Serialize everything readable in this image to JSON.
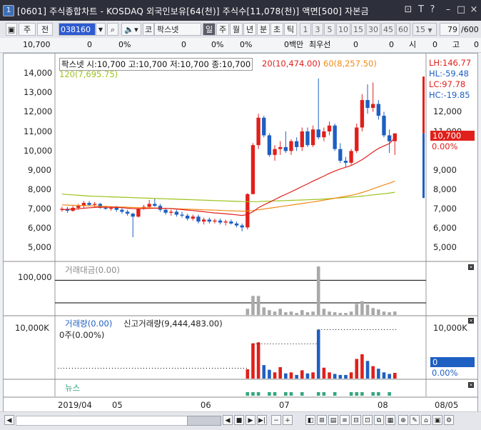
{
  "window": {
    "icon_label": "1",
    "title": "[0601] 주식종합차트 - KOSDAQ 외국인보유[64(천)] 주식수[11,078(천)] 액면[500] 자본금",
    "buttons": [
      "⊡",
      "T",
      "?",
      "–",
      "□",
      "×"
    ]
  },
  "toolbar": {
    "market": "주",
    "mode": "전",
    "code": "038160",
    "market_prefix": "코",
    "stock_name": "팍스넷",
    "period_buttons": [
      "일",
      "주",
      "월",
      "년",
      "분",
      "초",
      "틱"
    ],
    "interval_buttons": [
      "1",
      "3",
      "5",
      "10",
      "15",
      "30",
      "45",
      "60"
    ],
    "interval_selected": "15",
    "count": "79",
    "count_total": "/600"
  },
  "infobar": {
    "price": "10,700",
    "change": "0",
    "change_pct": "0%",
    "v1": "0",
    "v1_pct": "0%",
    "v2": "0",
    "v2_pct": "0%",
    "v3": "0",
    "v3_unit": "0백만",
    "label_best": "최우선",
    "best_val": "0",
    "label_open": "시",
    "open_val": "0",
    "label_high": "고",
    "high_val": "0"
  },
  "price_panel": {
    "legend_main": "팍스넷 시:10,700 고:10,700 저:10,700 종:10,700",
    "ma20": "20(10,474.00)",
    "ma60": "60(8,257.50)",
    "ma120": "120(7,695.75)",
    "left_ticks": [
      "14,000",
      "13,000",
      "12,000",
      "11,000",
      "10,000",
      "9,000",
      "8,000",
      "7,000",
      "6,000",
      "5,000"
    ],
    "right_ticks": [
      "12,000",
      "11,000",
      "10,000",
      "9,000",
      "8,000",
      "7,000",
      "6,000",
      "5,000"
    ],
    "lh": "LH:146.77",
    "hl": "HL:-59.48",
    "lc": "LC:97.78",
    "hc": "HC:-19.85",
    "current_price": "10,700",
    "current_pct": "0.00%"
  },
  "amount_panel": {
    "legend": "거래대금(0.00)",
    "left_tick": "100,000"
  },
  "volume_panel": {
    "legend": "거래량(0.00)",
    "new_high": "신고거래량(9,444,483.00)",
    "sub": "0주(0.00%)",
    "left_tick": "10,000K",
    "right_tick": "10,000K",
    "right_val": "0",
    "right_pct": "0.00%"
  },
  "news_panel": {
    "legend": "뉴스"
  },
  "xaxis": {
    "labels": [
      "2019/04",
      "05",
      "06",
      "07",
      "08"
    ],
    "right_date": "08/05"
  },
  "colors": {
    "up": "#e0201b",
    "down": "#1e5fc2",
    "ma20": "#e0201b",
    "ma60": "#f08a18",
    "ma120": "#9bc21c",
    "amount_bar": "#a9a9a9",
    "news_bar": "#35a87d"
  },
  "chart_data": {
    "type": "candlestick",
    "ylim": [
      4200,
      14700
    ],
    "candles": [
      {
        "o": 6800,
        "h": 6950,
        "l": 6700,
        "c": 6850
      },
      {
        "o": 6850,
        "h": 6950,
        "l": 6650,
        "c": 6750
      },
      {
        "o": 6750,
        "h": 7000,
        "l": 6700,
        "c": 6900
      },
      {
        "o": 6900,
        "h": 7100,
        "l": 6800,
        "c": 7000
      },
      {
        "o": 7000,
        "h": 7250,
        "l": 6900,
        "c": 7150
      },
      {
        "o": 7150,
        "h": 7250,
        "l": 7000,
        "c": 7050
      },
      {
        "o": 7050,
        "h": 7200,
        "l": 6900,
        "c": 7100
      },
      {
        "o": 7100,
        "h": 7150,
        "l": 6850,
        "c": 6900
      },
      {
        "o": 6900,
        "h": 7000,
        "l": 6800,
        "c": 6850
      },
      {
        "o": 6850,
        "h": 6950,
        "l": 6750,
        "c": 6900
      },
      {
        "o": 6900,
        "h": 7000,
        "l": 6700,
        "c": 6800
      },
      {
        "o": 6800,
        "h": 6900,
        "l": 6600,
        "c": 6700
      },
      {
        "o": 6700,
        "h": 6800,
        "l": 6500,
        "c": 6600
      },
      {
        "o": 6600,
        "h": 6650,
        "l": 5400,
        "c": 6450
      },
      {
        "o": 6450,
        "h": 6900,
        "l": 6400,
        "c": 6850
      },
      {
        "o": 6850,
        "h": 7050,
        "l": 6800,
        "c": 6950
      },
      {
        "o": 6950,
        "h": 7300,
        "l": 6900,
        "c": 7100
      },
      {
        "o": 7100,
        "h": 7400,
        "l": 6950,
        "c": 7000
      },
      {
        "o": 7000,
        "h": 7100,
        "l": 6700,
        "c": 6800
      },
      {
        "o": 6800,
        "h": 6900,
        "l": 6550,
        "c": 6650
      },
      {
        "o": 6650,
        "h": 6800,
        "l": 6500,
        "c": 6700
      },
      {
        "o": 6700,
        "h": 6800,
        "l": 6450,
        "c": 6550
      },
      {
        "o": 6550,
        "h": 6700,
        "l": 6400,
        "c": 6500
      },
      {
        "o": 6500,
        "h": 6600,
        "l": 6250,
        "c": 6350
      },
      {
        "o": 6350,
        "h": 6550,
        "l": 6250,
        "c": 6450
      },
      {
        "o": 6450,
        "h": 6550,
        "l": 6100,
        "c": 6200
      },
      {
        "o": 6200,
        "h": 6400,
        "l": 6050,
        "c": 6300
      },
      {
        "o": 6300,
        "h": 6400,
        "l": 6100,
        "c": 6200
      },
      {
        "o": 6200,
        "h": 6350,
        "l": 6100,
        "c": 6250
      },
      {
        "o": 6250,
        "h": 6350,
        "l": 6050,
        "c": 6150
      },
      {
        "o": 6150,
        "h": 6300,
        "l": 6000,
        "c": 6200
      },
      {
        "o": 6200,
        "h": 6300,
        "l": 6050,
        "c": 6100
      },
      {
        "o": 6100,
        "h": 6200,
        "l": 5900,
        "c": 6000
      },
      {
        "o": 6000,
        "h": 6100,
        "l": 5700,
        "c": 5900
      },
      {
        "o": 5900,
        "h": 7650,
        "l": 5800,
        "c": 7600
      },
      {
        "o": 7600,
        "h": 10200,
        "l": 7600,
        "c": 10100
      },
      {
        "o": 10100,
        "h": 11700,
        "l": 9900,
        "c": 11500
      },
      {
        "o": 11500,
        "h": 11600,
        "l": 10500,
        "c": 10600
      },
      {
        "o": 10600,
        "h": 10700,
        "l": 9500,
        "c": 9600
      },
      {
        "o": 9600,
        "h": 10100,
        "l": 9300,
        "c": 9900
      },
      {
        "o": 9900,
        "h": 10300,
        "l": 9600,
        "c": 10000
      },
      {
        "o": 10000,
        "h": 10800,
        "l": 9700,
        "c": 9800
      },
      {
        "o": 9800,
        "h": 10400,
        "l": 9600,
        "c": 10300
      },
      {
        "o": 10300,
        "h": 10500,
        "l": 9800,
        "c": 10000
      },
      {
        "o": 10000,
        "h": 11000,
        "l": 9800,
        "c": 10800
      },
      {
        "o": 10800,
        "h": 11000,
        "l": 10000,
        "c": 10100
      },
      {
        "o": 10100,
        "h": 11100,
        "l": 10000,
        "c": 10900
      },
      {
        "o": 10900,
        "h": 13500,
        "l": 10400,
        "c": 10500
      },
      {
        "o": 10500,
        "h": 11000,
        "l": 10300,
        "c": 10800
      },
      {
        "o": 10800,
        "h": 11300,
        "l": 10600,
        "c": 11100
      },
      {
        "o": 11100,
        "h": 11200,
        "l": 9800,
        "c": 9900
      },
      {
        "o": 9900,
        "h": 10200,
        "l": 9200,
        "c": 9300
      },
      {
        "o": 9300,
        "h": 9500,
        "l": 9000,
        "c": 9200
      },
      {
        "o": 9200,
        "h": 9900,
        "l": 9100,
        "c": 9800
      },
      {
        "o": 9800,
        "h": 11200,
        "l": 9700,
        "c": 11000
      },
      {
        "o": 11000,
        "h": 12700,
        "l": 10800,
        "c": 12400
      },
      {
        "o": 12400,
        "h": 13200,
        "l": 11700,
        "c": 12000
      },
      {
        "o": 12000,
        "h": 13300,
        "l": 11800,
        "c": 12200
      },
      {
        "o": 12200,
        "h": 12400,
        "l": 11400,
        "c": 11600
      },
      {
        "o": 11600,
        "h": 11800,
        "l": 10500,
        "c": 10600
      },
      {
        "o": 10600,
        "h": 10900,
        "l": 9700,
        "c": 10300
      },
      {
        "o": 10300,
        "h": 10700,
        "l": 9600,
        "c": 10700
      }
    ],
    "ma20": [
      6800,
      6820,
      6830,
      6850,
      6880,
      6900,
      6920,
      6930,
      6930,
      6930,
      6920,
      6910,
      6880,
      6860,
      6850,
      6860,
      6870,
      6880,
      6880,
      6870,
      6860,
      6840,
      6810,
      6780,
      6760,
      6730,
      6700,
      6670,
      6640,
      6620,
      6590,
      6570,
      6540,
      6510,
      6560,
      6700,
      6900,
      7050,
      7180,
      7320,
      7460,
      7590,
      7720,
      7850,
      7990,
      8120,
      8260,
      8390,
      8520,
      8660,
      8780,
      8880,
      8970,
      9060,
      9200,
      9360,
      9550,
      9750,
      9930,
      10060,
      10180,
      10474
    ],
    "ma60": [
      7050,
      7040,
      7030,
      7020,
      7010,
      7000,
      6990,
      6980,
      6970,
      6960,
      6950,
      6940,
      6930,
      6920,
      6910,
      6900,
      6900,
      6890,
      6880,
      6870,
      6860,
      6850,
      6840,
      6830,
      6820,
      6810,
      6800,
      6790,
      6780,
      6770,
      6760,
      6750,
      6740,
      6730,
      6740,
      6760,
      6800,
      6840,
      6880,
      6920,
      6960,
      7000,
      7040,
      7080,
      7120,
      7160,
      7200,
      7240,
      7290,
      7340,
      7390,
      7440,
      7490,
      7540,
      7600,
      7680,
      7770,
      7870,
      7970,
      8070,
      8160,
      8257.5
    ],
    "ma120": [
      7600,
      7580,
      7560,
      7540,
      7520,
      7500,
      7490,
      7480,
      7470,
      7460,
      7450,
      7440,
      7430,
      7420,
      7410,
      7400,
      7390,
      7380,
      7370,
      7360,
      7350,
      7340,
      7330,
      7320,
      7310,
      7300,
      7290,
      7280,
      7270,
      7260,
      7250,
      7240,
      7230,
      7220,
      7215,
      7215,
      7220,
      7230,
      7240,
      7250,
      7260,
      7270,
      7280,
      7290,
      7300,
      7310,
      7320,
      7330,
      7350,
      7370,
      7390,
      7410,
      7430,
      7450,
      7470,
      7500,
      7530,
      7560,
      7590,
      7620,
      7650,
      7695.75
    ],
    "amount_ylim": [
      0,
      140000
    ],
    "amount": [
      0,
      0,
      0,
      0,
      0,
      0,
      0,
      0,
      0,
      0,
      0,
      0,
      0,
      0,
      0,
      0,
      0,
      0,
      0,
      0,
      0,
      0,
      0,
      0,
      0,
      0,
      0,
      0,
      0,
      0,
      0,
      0,
      0,
      0,
      18000,
      55000,
      55000,
      22000,
      14000,
      10000,
      18000,
      8000,
      10000,
      6000,
      14000,
      8000,
      10000,
      140000,
      18000,
      10000,
      8000,
      6000,
      6000,
      10000,
      32000,
      40000,
      30000,
      20000,
      16000,
      10000,
      8000,
      10000
    ],
    "volume_ylim": [
      0,
      12000
    ],
    "volume": [
      0,
      0,
      0,
      0,
      0,
      0,
      0,
      0,
      0,
      0,
      0,
      0,
      0,
      0,
      0,
      0,
      0,
      0,
      0,
      0,
      0,
      0,
      0,
      0,
      0,
      0,
      0,
      0,
      0,
      0,
      0,
      0,
      0,
      0,
      1800,
      6800,
      7000,
      2600,
      1700,
      1200,
      2200,
      1000,
      1200,
      700,
      1600,
      1000,
      1200,
      9444,
      2100,
      1200,
      900,
      700,
      700,
      1200,
      3800,
      4700,
      3400,
      2400,
      1900,
      1200,
      900,
      1100
    ],
    "news": [
      0,
      0,
      0,
      0,
      0,
      0,
      0,
      0,
      0,
      0,
      0,
      0,
      0,
      0,
      0,
      0,
      0,
      0,
      0,
      0,
      0,
      0,
      0,
      0,
      0,
      0,
      0,
      0,
      0,
      0,
      0,
      0,
      0,
      0,
      1,
      1,
      1,
      0,
      1,
      1,
      0,
      1,
      1,
      0,
      1,
      0,
      0,
      1,
      1,
      0,
      1,
      0,
      0,
      1,
      1,
      1,
      0,
      1,
      1,
      0,
      1,
      0
    ]
  }
}
